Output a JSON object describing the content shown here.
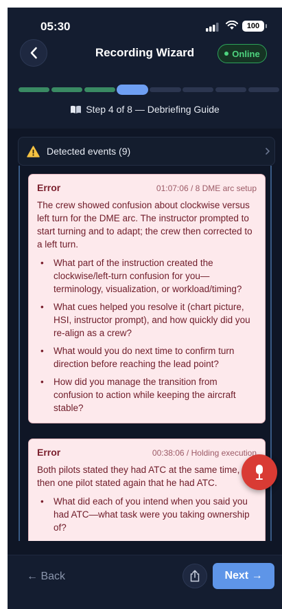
{
  "status_bar": {
    "time": "05:30",
    "battery": "100"
  },
  "header": {
    "title": "Recording Wizard",
    "status_badge": "Online"
  },
  "progress": {
    "current_step": 4,
    "total_steps": 8,
    "label": "Step 4 of 8 — Debriefing Guide"
  },
  "events_panel": {
    "label": "Detected events (9)"
  },
  "events": [
    {
      "kind": "Error",
      "meta": "01:07:06 / 8 DME arc setup",
      "description": "The crew showed confusion about clockwise versus left turn for the DME arc. The instructor prompted to start turning and to adapt; the crew then corrected to a left turn.",
      "questions": [
        "What part of the instruction created the clockwise/left-turn confusion for you—terminology, visualization, or workload/timing?",
        "What cues helped you resolve it (chart picture, HSI, instructor prompt), and how quickly did you re-align as a crew?",
        "What would you do next time to confirm turn direction before reaching the lead point?",
        "How did you manage the transition from confusion to action while keeping the aircraft stable?"
      ]
    },
    {
      "kind": "Error",
      "meta": "00:38:06 / Holding execution",
      "description": "Both pilots stated they had ATC at the same time, then one pilot stated again that he had ATC.",
      "questions": [
        "What did each of you intend when you said you had ATC—what task were you taking ownership of?"
      ]
    }
  ],
  "footer": {
    "back_label": "← Back",
    "next_label": "Next →"
  },
  "colors": {
    "accent": "#5e95e8",
    "online": "#4ed47f",
    "error_card": "#fde9ec",
    "mic": "#d93b34"
  }
}
